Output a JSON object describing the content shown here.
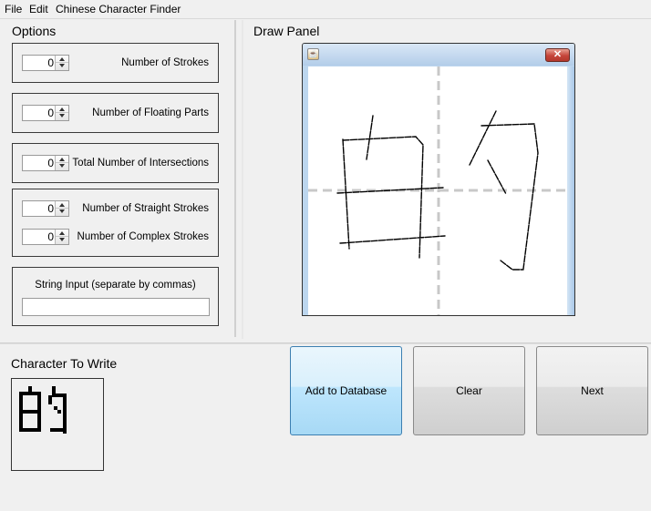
{
  "menubar": {
    "items": [
      {
        "label": "File"
      },
      {
        "label": "Edit"
      },
      {
        "label": "Chinese Character Finder"
      }
    ]
  },
  "options": {
    "title": "Options",
    "strokes": {
      "label": "Number of Strokes",
      "value": "0"
    },
    "floating_parts": {
      "label": "Number of Floating Parts",
      "value": "0"
    },
    "intersections": {
      "label": "Total Number of Intersections",
      "value": "0"
    },
    "straight_strokes": {
      "label": "Number of Straight Strokes",
      "value": "0"
    },
    "complex_strokes": {
      "label": "Number of Complex Strokes",
      "value": "0"
    },
    "string_input": {
      "label": "String Input (separate by commas)",
      "value": ""
    }
  },
  "draw_panel": {
    "title": "Draw Panel",
    "window_close_icon": "close-icon",
    "app_icon": "java-cup-icon",
    "grid_color": "#c8c8c8",
    "stroke_color": "#000000"
  },
  "character_to_write": {
    "title": "Character To Write",
    "glyph": "的"
  },
  "buttons": {
    "add": "Add to Database",
    "clear": "Clear",
    "next": "Next"
  },
  "colors": {
    "window_bg": "#f0f0f0",
    "primary_button": "#bee6fd",
    "titlebar": "#b3cde9"
  }
}
